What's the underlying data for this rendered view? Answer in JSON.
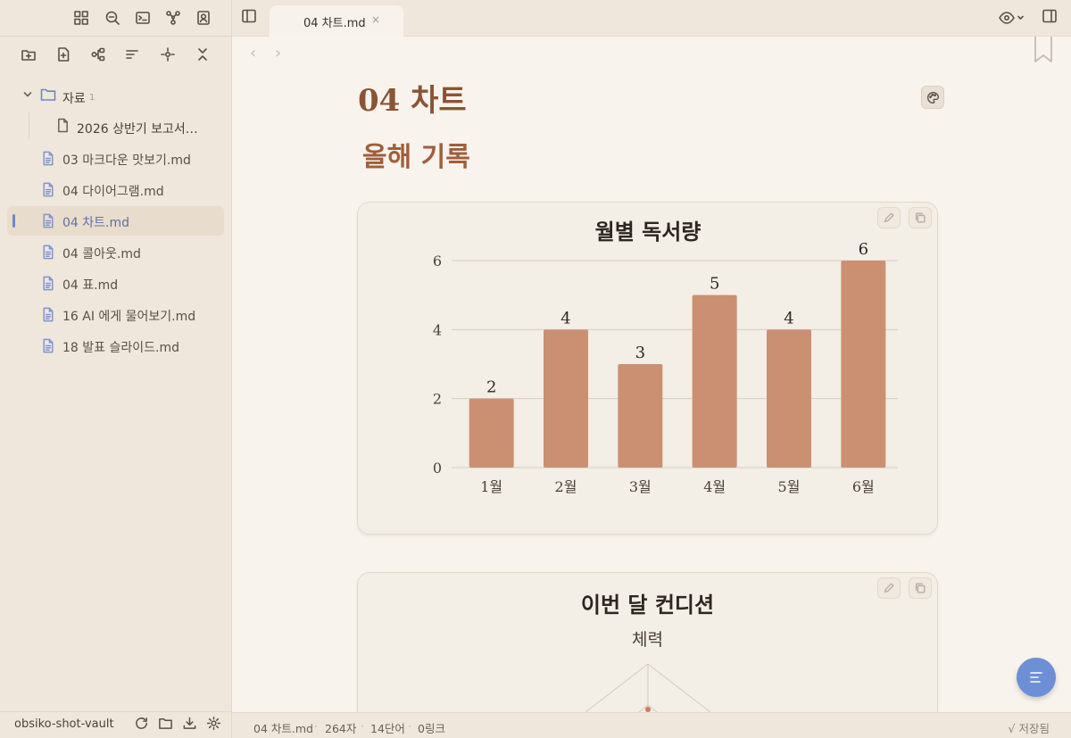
{
  "sidebar": {
    "ribbon_icons": [
      "grid-icon",
      "zoom-out-icon",
      "terminal-icon",
      "graph-icon",
      "contact-icon"
    ],
    "explorer_icons": [
      "new-folder-icon",
      "new-note-icon",
      "structure-icon",
      "sort-icon",
      "locate-icon",
      "collapse-icon"
    ],
    "folder": {
      "name": "자료",
      "count": "1",
      "child": "2026 상반기 보고서…"
    },
    "files": [
      {
        "name": "03 마크다운 맛보기.md",
        "active": false
      },
      {
        "name": "04 다이어그램.md",
        "active": false
      },
      {
        "name": "04 차트.md",
        "active": true
      },
      {
        "name": "04 콜아웃.md",
        "active": false
      },
      {
        "name": "04 표.md",
        "active": false
      },
      {
        "name": "16 AI 에게 물어보기.md",
        "active": false
      },
      {
        "name": "18 발표 슬라이드.md",
        "active": false
      }
    ],
    "vault_name": "obsiko-shot-vault"
  },
  "tabbar": {
    "tab_title": "04 차트.md",
    "close_glyph": "×"
  },
  "main": {
    "nav_back": "‹",
    "nav_forward": "›",
    "page_title": "04 차트",
    "heading": "올해 기록",
    "chart2_title": "이번 달 컨디션",
    "chart2_axis_top": "체력"
  },
  "chart_data": [
    {
      "type": "bar",
      "title": "월별 독서량",
      "categories": [
        "1월",
        "2월",
        "3월",
        "4월",
        "5월",
        "6월"
      ],
      "values": [
        2,
        4,
        3,
        5,
        4,
        6
      ],
      "ylim": [
        0,
        6
      ],
      "yticks": [
        0,
        2,
        4,
        6
      ],
      "grid": true,
      "bar_color": "#cb9072",
      "xlabel": "",
      "ylabel": ""
    }
  ],
  "statusbar": {
    "file": "04 차트.md",
    "chars": "264자",
    "words": "14단어",
    "links": "0링크",
    "saved": "√ 저장됨"
  },
  "colors": {
    "accent": "#6c8fd6",
    "title": "#8a5435",
    "heading": "#a05e3c",
    "bar": "#cb9072",
    "sidebar_bg": "#efe7dc",
    "page_bg": "#f8f4ed"
  }
}
